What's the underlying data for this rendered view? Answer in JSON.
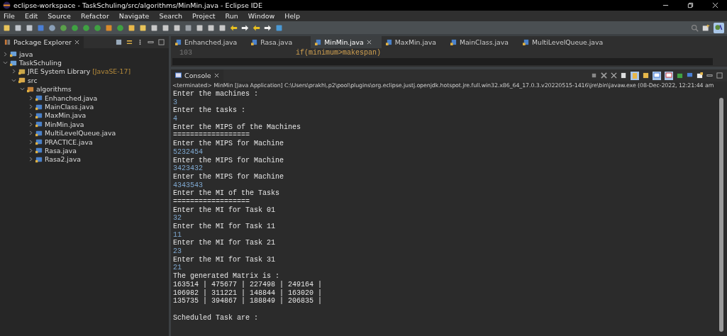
{
  "window": {
    "title": "eclipse-workspace - TaskSchuling/src/algorithms/MinMin.java - Eclipse IDE"
  },
  "menu": [
    "File",
    "Edit",
    "Source",
    "Refactor",
    "Navigate",
    "Search",
    "Project",
    "Run",
    "Window",
    "Help"
  ],
  "package_explorer": {
    "title": "Package Explorer",
    "tree": [
      {
        "label": "java",
        "kind": "project",
        "expanded": false
      },
      {
        "label": "TaskSchuling",
        "kind": "project",
        "expanded": true,
        "children": [
          {
            "label": "JRE System Library",
            "decoration": "[JavaSE-17]",
            "kind": "library",
            "expanded": false
          },
          {
            "label": "src",
            "kind": "folder",
            "expanded": true,
            "children": [
              {
                "label": "algorithms",
                "kind": "package",
                "expanded": true,
                "children": [
                  {
                    "label": "Enhanched.java",
                    "kind": "file",
                    "expanded": false
                  },
                  {
                    "label": "MainClass.java",
                    "kind": "file",
                    "expanded": false
                  },
                  {
                    "label": "MaxMin.java",
                    "kind": "file",
                    "expanded": false
                  },
                  {
                    "label": "MinMin.java",
                    "kind": "file",
                    "expanded": false
                  },
                  {
                    "label": "MultiLevelQueue.java",
                    "kind": "file",
                    "expanded": false
                  },
                  {
                    "label": "PRACTICE.java",
                    "kind": "file",
                    "expanded": false
                  },
                  {
                    "label": "Rasa.java",
                    "kind": "file",
                    "expanded": false
                  },
                  {
                    "label": "Rasa2.java",
                    "kind": "file",
                    "expanded": false
                  }
                ]
              }
            ]
          }
        ]
      }
    ]
  },
  "editor": {
    "tabs": [
      {
        "label": "Enhanched.java",
        "selected": false
      },
      {
        "label": "Rasa.java",
        "selected": false
      },
      {
        "label": "MinMin.java",
        "selected": true
      },
      {
        "label": "MaxMin.java",
        "selected": false
      },
      {
        "label": "MainClass.java",
        "selected": false
      },
      {
        "label": "MultiLevelQueue.java",
        "selected": false
      }
    ],
    "lines": [
      {
        "number": "103",
        "code": "if(minimum>makespan)"
      }
    ]
  },
  "console": {
    "title": "Console",
    "status": "<terminated> MinMin [Java Application] C:\\Users\\prakh\\.p2\\pool\\plugins\\org.eclipse.justj.openjdk.hotspot.jre.full.win32.x86_64_17.0.3.v20220515-1416\\jre\\bin\\javaw.exe  (08-Dec-2022, 12:21:44 am",
    "lines": [
      {
        "kind": "output",
        "text": "Enter the machines :"
      },
      {
        "kind": "input",
        "text": "3"
      },
      {
        "kind": "output",
        "text": "Enter the tasks :"
      },
      {
        "kind": "input",
        "text": "4"
      },
      {
        "kind": "output",
        "text": "Enter the MIPS of the Machines"
      },
      {
        "kind": "output",
        "text": "=================="
      },
      {
        "kind": "output",
        "text": "Enter the MIPS for Machine"
      },
      {
        "kind": "input",
        "text": "5232454"
      },
      {
        "kind": "output",
        "text": "Enter the MIPS for Machine"
      },
      {
        "kind": "input",
        "text": "3423432"
      },
      {
        "kind": "output",
        "text": "Enter the MIPS for Machine"
      },
      {
        "kind": "input",
        "text": "4343543"
      },
      {
        "kind": "output",
        "text": "Enter the MI of the Tasks"
      },
      {
        "kind": "output",
        "text": "=================="
      },
      {
        "kind": "output",
        "text": "Enter the MI for Task 01"
      },
      {
        "kind": "input",
        "text": "32"
      },
      {
        "kind": "output",
        "text": "Enter the MI for Task 11"
      },
      {
        "kind": "input",
        "text": "11"
      },
      {
        "kind": "output",
        "text": "Enter the MI for Task 21"
      },
      {
        "kind": "input",
        "text": "23"
      },
      {
        "kind": "output",
        "text": "Enter the MI for Task 31"
      },
      {
        "kind": "input",
        "text": "21"
      },
      {
        "kind": "output",
        "text": "The generated Matrix is :"
      },
      {
        "kind": "output",
        "text": "163514 | 475677 | 227498 | 249164 |"
      },
      {
        "kind": "output",
        "text": "106982 | 311221 | 148844 | 163020 |"
      },
      {
        "kind": "output",
        "text": "135735 | 394867 | 188849 | 206835 |"
      },
      {
        "kind": "blank"
      },
      {
        "kind": "output",
        "text": "Scheduled Task are :"
      }
    ]
  }
}
